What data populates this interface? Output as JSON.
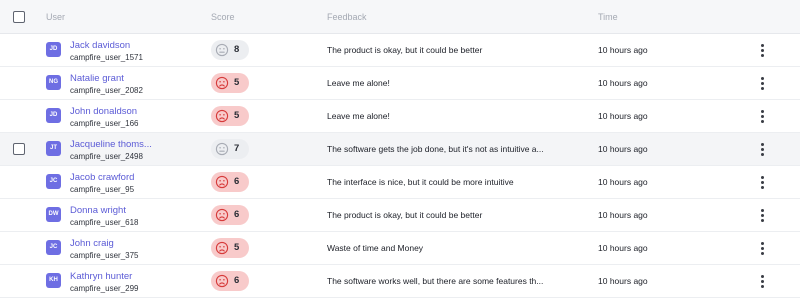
{
  "header": {
    "user": "User",
    "score": "Score",
    "feedback": "Feedback",
    "time": "Time"
  },
  "colors": {
    "accent": "#5b5bd6",
    "avatar": "#6e6ee3",
    "low_score_bg": "#f8caca",
    "neutral_score_bg": "#eceef1"
  },
  "rows": [
    {
      "initials": "JD",
      "name": "Jack davidson",
      "handle": "campfire_user_1571",
      "score": "8",
      "sentiment": "neutral-face-icon",
      "feedback": "The product is okay, but it could be better",
      "time": "10 hours ago"
    },
    {
      "initials": "NG",
      "name": "Natalie grant",
      "handle": "campfire_user_2082",
      "score": "5",
      "sentiment": "sad-face-icon",
      "feedback": "Leave me alone!",
      "time": "10 hours ago"
    },
    {
      "initials": "JD",
      "name": "John donaldson",
      "handle": "campfire_user_166",
      "score": "5",
      "sentiment": "sad-face-icon",
      "feedback": "Leave me alone!",
      "time": "10 hours ago"
    },
    {
      "initials": "JT",
      "name": "Jacqueline thoms...",
      "handle": "campfire_user_2498",
      "score": "7",
      "sentiment": "neutral-face-icon",
      "feedback": "The software gets the job done, but it's not as intuitive a...",
      "time": "10 hours ago"
    },
    {
      "initials": "JC",
      "name": "Jacob crawford",
      "handle": "campfire_user_95",
      "score": "6",
      "sentiment": "sad-face-icon",
      "feedback": "The interface is nice, but it could be more intuitive",
      "time": "10 hours ago"
    },
    {
      "initials": "DW",
      "name": "Donna wright",
      "handle": "campfire_user_618",
      "score": "6",
      "sentiment": "sad-face-icon",
      "feedback": "The product is okay, but it could be better",
      "time": "10 hours ago"
    },
    {
      "initials": "JC",
      "name": "John craig",
      "handle": "campfire_user_375",
      "score": "5",
      "sentiment": "sad-face-icon",
      "feedback": "Waste of time and Money",
      "time": "10 hours ago"
    },
    {
      "initials": "KH",
      "name": "Kathryn hunter",
      "handle": "campfire_user_299",
      "score": "6",
      "sentiment": "sad-face-icon",
      "feedback": "The software works well, but there are some features th...",
      "time": "10 hours ago"
    }
  ]
}
